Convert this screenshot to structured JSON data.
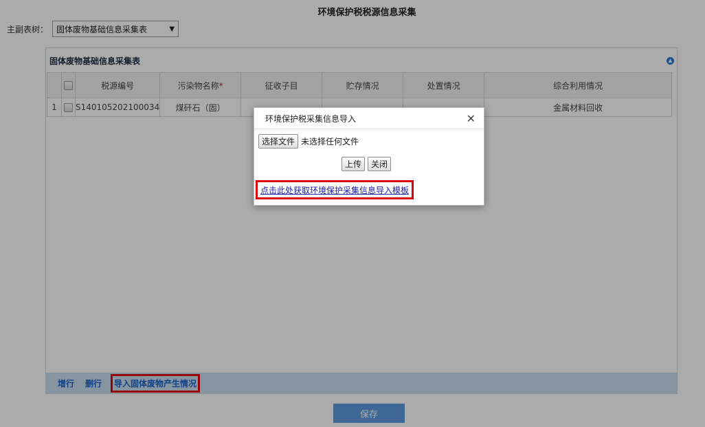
{
  "page": {
    "title": "环境保护税税源信息采集"
  },
  "tree": {
    "label": "主副表树：",
    "selected": "固体废物基础信息采集表"
  },
  "panel": {
    "title": "固体废物基础信息采集表",
    "columns": [
      "税源编号",
      "污染物名称",
      "征收子目",
      "贮存情况",
      "处置情况",
      "综合利用情况"
    ],
    "required_mark": "*",
    "rows": [
      {
        "index": "1",
        "tax_source_no": "S140105202100034",
        "pollutant": "煤矸石（固）",
        "sub_item": "",
        "storage": "",
        "disposal": "",
        "utilization": "金属材料回收"
      }
    ],
    "footer": {
      "add_row": "增行",
      "delete_row": "删行",
      "import": "导入固体废物产生情况"
    }
  },
  "save_label": "保存",
  "dialog": {
    "title": "环境保护税采集信息导入",
    "choose_file": "选择文件",
    "no_file": "未选择任何文件",
    "upload": "上传",
    "close": "关闭",
    "template_link": "点击此处获取环境保护采集信息导入模板"
  },
  "colors": {
    "accent": "#5b9be0",
    "footer_bg": "#c9dff2",
    "highlight": "#e0000a",
    "link": "#1a62c7"
  }
}
